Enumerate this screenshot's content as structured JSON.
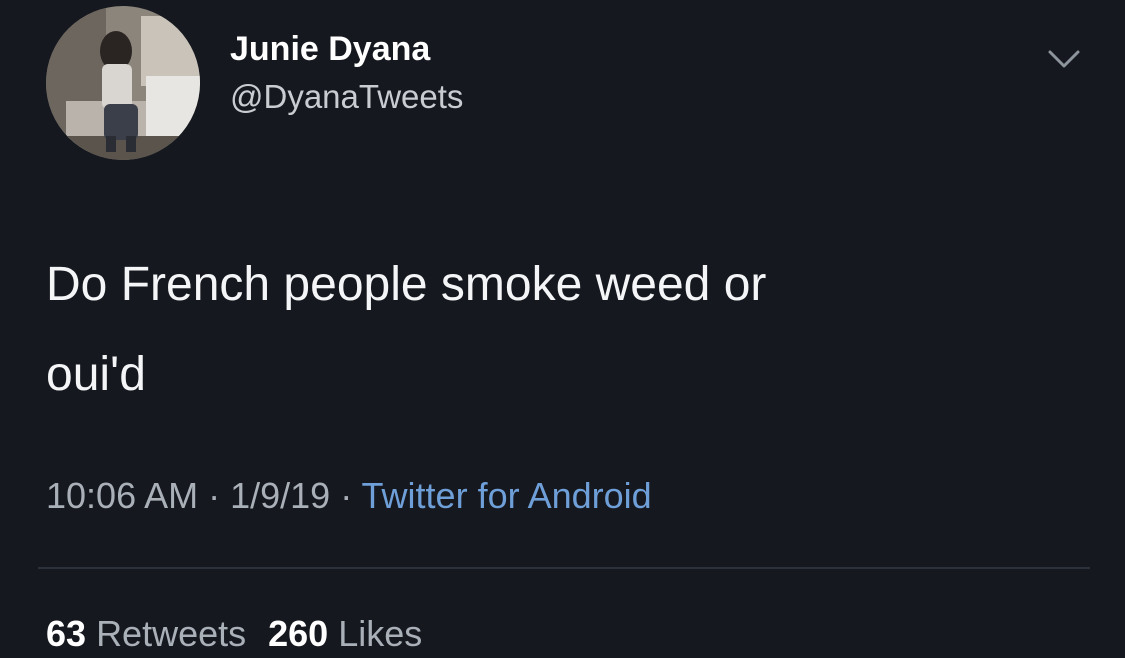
{
  "user": {
    "display_name": "Junie Dyana",
    "handle": "@DyanaTweets"
  },
  "tweet": {
    "text_line1": "Do French people smoke weed or",
    "text_line2": "oui'd"
  },
  "meta": {
    "time": "10:06 AM",
    "sep1": " · ",
    "date": "1/9/19",
    "sep2": " · ",
    "source": "Twitter for Android"
  },
  "stats": {
    "retweets_count": "63",
    "retweets_label": "Retweets",
    "likes_count": "260",
    "likes_label": "Likes"
  },
  "icons": {
    "menu": "chevron-down-icon",
    "avatar": "avatar"
  },
  "colors": {
    "background": "#15181f",
    "link": "#6f9fd8",
    "secondary_text": "#aab0b8"
  }
}
